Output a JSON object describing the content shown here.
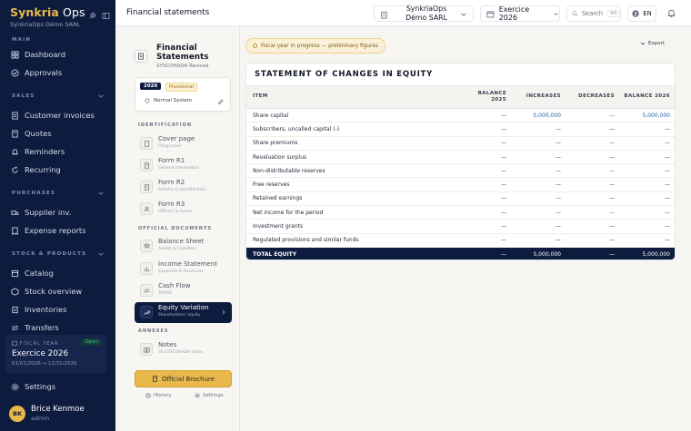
{
  "brand": {
    "name_accent": "Synkria",
    "name_rest": " Ops",
    "company": "SynkriaOps Démo SARL"
  },
  "sidebar": {
    "sections": [
      {
        "label": "MAIN",
        "items": [
          {
            "label": "Dashboard",
            "icon": "grid-icon"
          },
          {
            "label": "Approvals",
            "icon": "check-circle-icon"
          }
        ]
      },
      {
        "label": "SALES",
        "items": [
          {
            "label": "Customer invoices",
            "icon": "invoice-icon"
          },
          {
            "label": "Quotes",
            "icon": "quote-icon"
          },
          {
            "label": "Reminders",
            "icon": "reminder-icon"
          },
          {
            "label": "Recurring",
            "icon": "recurring-icon"
          }
        ]
      },
      {
        "label": "PURCHASES",
        "items": [
          {
            "label": "Supplier inv.",
            "icon": "truck-icon"
          },
          {
            "label": "Expense reports",
            "icon": "receipt-icon"
          }
        ]
      },
      {
        "label": "STOCK & PRODUCTS",
        "items": [
          {
            "label": "Catalog",
            "icon": "catalog-icon"
          },
          {
            "label": "Stock overview",
            "icon": "stock-icon"
          },
          {
            "label": "Inventories",
            "icon": "inventory-icon"
          },
          {
            "label": "Transfers",
            "icon": "transfer-icon"
          }
        ]
      }
    ],
    "fiscal_year": {
      "label": "FISCAL YEAR",
      "status": "Open",
      "title": "Exercice 2026",
      "range": "01/01/2026 → 12/31/2026"
    },
    "settings_label": "Settings",
    "user": {
      "initials": "BK",
      "name": "Brice Kenmoe",
      "role": "admin"
    }
  },
  "topbar": {
    "title": "Financial statements",
    "company": "SynkriaOps Démo SARL",
    "year": "Exercice 2026",
    "search_placeholder": "Search",
    "search_shortcut": "⌘K",
    "lang": "EN"
  },
  "doc_panel": {
    "title": "Financial Statements",
    "subtitle": "SYSCOHADA Revised",
    "year_card": {
      "year": "2026",
      "status": "Provisional",
      "system": "Normal System"
    },
    "sections": [
      {
        "label": "IDENTIFICATION",
        "items": [
          {
            "title": "Cover page",
            "sub": "Filing cover"
          },
          {
            "title": "Form R1",
            "sub": "General information"
          },
          {
            "title": "Form R2",
            "sub": "Activity & identification"
          },
          {
            "title": "Form R3",
            "sub": "Officers & board"
          }
        ]
      },
      {
        "label": "OFFICIAL DOCUMENTS",
        "items": [
          {
            "title": "Balance Sheet",
            "sub": "Assets & Liabilities"
          },
          {
            "title": "Income Statement",
            "sub": "Expenses & Revenues"
          },
          {
            "title": "Cash Flow",
            "sub": "TAFIRE"
          },
          {
            "title": "Equity Variation",
            "sub": "Shareholders' equity",
            "active": true
          }
        ]
      },
      {
        "label": "ANNEXES",
        "items": [
          {
            "title": "Notes",
            "sub": "36 SYSCOHADA notes"
          }
        ]
      }
    ],
    "brochure_label": "Official Brochure",
    "history_label": "History",
    "settings_label": "Settings"
  },
  "main": {
    "banner": "Fiscal year in progress — preliminary figures",
    "export_label": "Export",
    "table": {
      "title": "STATEMENT OF CHANGES IN EQUITY",
      "headers": {
        "item": "ITEM",
        "balance_start": "BALANCE 2025",
        "increases": "INCREASES",
        "decreases": "DECREASES",
        "balance_end": "BALANCE 2026"
      },
      "rows": [
        {
          "item": "Share capital",
          "b1": "—",
          "inc": "5,000,000",
          "dec": "—",
          "b2": "5,000,000"
        },
        {
          "item": "Subscribers, uncalled capital (-)",
          "b1": "—",
          "inc": "—",
          "dec": "—",
          "b2": "—"
        },
        {
          "item": "Share premiums",
          "b1": "—",
          "inc": "—",
          "dec": "—",
          "b2": "—"
        },
        {
          "item": "Revaluation surplus",
          "b1": "—",
          "inc": "—",
          "dec": "—",
          "b2": "—"
        },
        {
          "item": "Non-distributable reserves",
          "b1": "—",
          "inc": "—",
          "dec": "—",
          "b2": "—"
        },
        {
          "item": "Free reserves",
          "b1": "—",
          "inc": "—",
          "dec": "—",
          "b2": "—"
        },
        {
          "item": "Retained earnings",
          "b1": "—",
          "inc": "—",
          "dec": "—",
          "b2": "—"
        },
        {
          "item": "Net income for the period",
          "b1": "—",
          "inc": "—",
          "dec": "—",
          "b2": "—"
        },
        {
          "item": "Investment grants",
          "b1": "—",
          "inc": "—",
          "dec": "—",
          "b2": "—"
        },
        {
          "item": "Regulated provisions and similar funds",
          "b1": "—",
          "inc": "—",
          "dec": "—",
          "b2": "—"
        }
      ],
      "total": {
        "item": "TOTAL EQUITY",
        "b1": "—",
        "inc": "5,000,000",
        "dec": "—",
        "b2": "5,000,000"
      }
    }
  },
  "colors": {
    "navy": "#0d1b3e",
    "gold": "#e8b84a",
    "positive": "#2563a8",
    "negative": "#b45a4a"
  }
}
